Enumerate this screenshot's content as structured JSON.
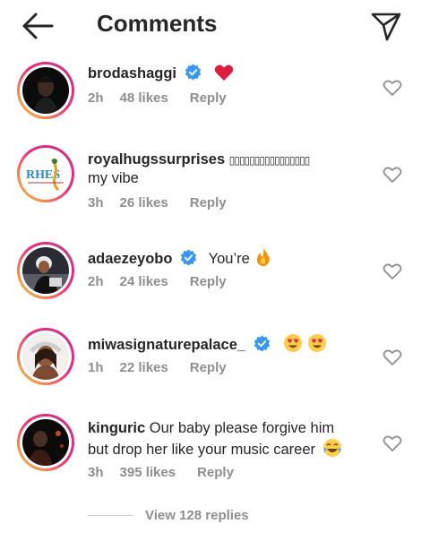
{
  "header": {
    "title": "Comments"
  },
  "comments": [
    {
      "username": "brodashaggi",
      "verified": true,
      "text": "",
      "emoji": "heart",
      "time": "2h",
      "likes": "48 likes",
      "reply": "Reply"
    },
    {
      "username": "royalhugssurprises",
      "verified": false,
      "text": "▯▯▯▯▯▯▯▯▯▯▯▯▯▯▯▯",
      "text2": "my vibe",
      "time": "3h",
      "likes": "26 likes",
      "reply": "Reply"
    },
    {
      "username": "adaezeyobo",
      "verified": true,
      "text": "You’re",
      "emoji": "fire",
      "time": "2h",
      "likes": "24 likes",
      "reply": "Reply"
    },
    {
      "username": "miwasignaturepalace_",
      "verified": true,
      "text": "",
      "emoji": "heart-eyes",
      "time": "1h",
      "likes": "22 likes",
      "reply": "Reply"
    },
    {
      "username": "kinguric",
      "verified": false,
      "text": "Our baby please forgive him",
      "text2": "but drop her like your music career",
      "emoji": "laughing",
      "time": "3h",
      "likes": "395 likes",
      "reply": "Reply"
    }
  ],
  "view_replies": "View 128 replies",
  "colors": {
    "verified": "#3897f0",
    "meta": "#8e8e8e",
    "heart": "#e0245e"
  }
}
